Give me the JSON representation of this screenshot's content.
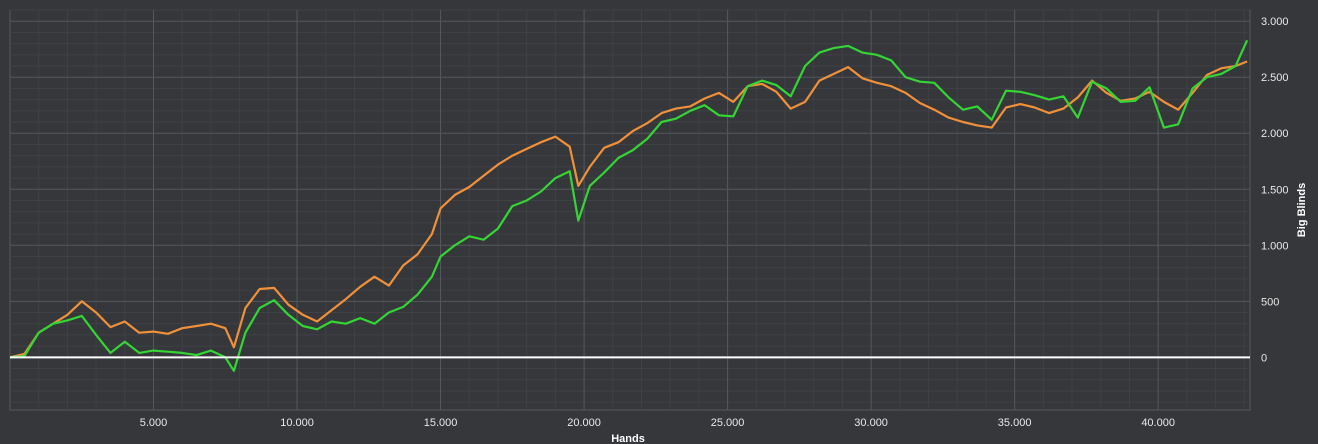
{
  "colors": {
    "background": "#35373b",
    "grid_major": "#55585c",
    "grid_minor": "#3e4145",
    "zero_line": "#ffffff",
    "series_orange": "#f0913a",
    "series_green": "#34d534"
  },
  "chart_data": {
    "type": "line",
    "title": "",
    "xlabel": "Hands",
    "ylabel": "Big Blinds",
    "xlim": [
      0,
      43200
    ],
    "ylim": [
      -470,
      3100
    ],
    "grid": true,
    "y_axis_side": "right",
    "x_ticks": [
      5000,
      10000,
      15000,
      20000,
      25000,
      30000,
      35000,
      40000
    ],
    "x_tick_labels": [
      "5.000",
      "10.000",
      "15.000",
      "20.000",
      "25.000",
      "30.000",
      "35.000",
      "40.000"
    ],
    "y_ticks": [
      0,
      500,
      1000,
      1500,
      2000,
      2500,
      3000
    ],
    "y_tick_labels": [
      "0",
      "500",
      "1.000",
      "1.500",
      "2.000",
      "2.500",
      "3.000"
    ],
    "series": [
      {
        "color": "#f0913a",
        "x": [
          0,
          500,
          1000,
          1500,
          2000,
          2500,
          3000,
          3500,
          4000,
          4500,
          5000,
          5500,
          6000,
          6500,
          7000,
          7500,
          7800,
          8200,
          8700,
          9200,
          9700,
          10200,
          10700,
          11200,
          11700,
          12200,
          12700,
          13200,
          13700,
          14200,
          14700,
          15000,
          15500,
          16000,
          16500,
          17000,
          17500,
          18000,
          18500,
          19000,
          19500,
          19800,
          20200,
          20700,
          21200,
          21700,
          22200,
          22700,
          23200,
          23700,
          24200,
          24700,
          25200,
          25700,
          26200,
          26700,
          27200,
          27700,
          28200,
          28700,
          29200,
          29700,
          30200,
          30700,
          31200,
          31700,
          32200,
          32700,
          33200,
          33700,
          34200,
          34700,
          35200,
          35700,
          36200,
          36700,
          37200,
          37700,
          38200,
          38700,
          39200,
          39700,
          40200,
          40700,
          41200,
          41700,
          42200,
          42700,
          43100
        ],
        "y": [
          0,
          30,
          220,
          300,
          380,
          500,
          400,
          270,
          320,
          220,
          230,
          210,
          260,
          280,
          300,
          260,
          90,
          440,
          610,
          620,
          470,
          380,
          320,
          420,
          520,
          630,
          720,
          640,
          820,
          920,
          1100,
          1330,
          1450,
          1520,
          1620,
          1720,
          1800,
          1860,
          1920,
          1970,
          1880,
          1530,
          1700,
          1870,
          1920,
          2020,
          2090,
          2180,
          2220,
          2240,
          2310,
          2360,
          2280,
          2420,
          2440,
          2370,
          2220,
          2280,
          2470,
          2530,
          2590,
          2490,
          2450,
          2420,
          2360,
          2270,
          2210,
          2140,
          2100,
          2070,
          2050,
          2230,
          2260,
          2230,
          2180,
          2220,
          2320,
          2470,
          2360,
          2290,
          2310,
          2370,
          2280,
          2210,
          2360,
          2520,
          2580,
          2600,
          2640
        ]
      },
      {
        "color": "#34d534",
        "x": [
          0,
          500,
          1000,
          1500,
          2000,
          2500,
          3000,
          3500,
          4000,
          4500,
          5000,
          5500,
          6000,
          6500,
          7000,
          7500,
          7800,
          8200,
          8700,
          9200,
          9700,
          10200,
          10700,
          11200,
          11700,
          12200,
          12700,
          13200,
          13700,
          14200,
          14700,
          15000,
          15500,
          16000,
          16500,
          17000,
          17500,
          18000,
          18500,
          19000,
          19500,
          19800,
          20200,
          20700,
          21200,
          21700,
          22200,
          22700,
          23200,
          23700,
          24200,
          24700,
          25200,
          25700,
          26200,
          26700,
          27200,
          27700,
          28200,
          28700,
          29200,
          29700,
          30200,
          30700,
          31200,
          31700,
          32200,
          32700,
          33200,
          33700,
          34200,
          34700,
          35200,
          35700,
          36200,
          36700,
          37200,
          37700,
          38200,
          38700,
          39200,
          39700,
          40200,
          40700,
          41200,
          41700,
          42200,
          42700,
          43100
        ],
        "y": [
          0,
          10,
          220,
          300,
          330,
          370,
          200,
          40,
          140,
          40,
          60,
          50,
          40,
          20,
          60,
          0,
          -120,
          220,
          440,
          510,
          380,
          280,
          250,
          320,
          300,
          350,
          300,
          400,
          450,
          560,
          720,
          900,
          1000,
          1080,
          1050,
          1150,
          1350,
          1400,
          1480,
          1600,
          1660,
          1220,
          1530,
          1650,
          1780,
          1850,
          1950,
          2100,
          2130,
          2200,
          2250,
          2160,
          2150,
          2420,
          2470,
          2430,
          2330,
          2600,
          2720,
          2760,
          2780,
          2720,
          2700,
          2650,
          2500,
          2460,
          2450,
          2320,
          2210,
          2240,
          2120,
          2380,
          2370,
          2340,
          2300,
          2330,
          2140,
          2460,
          2400,
          2280,
          2290,
          2410,
          2050,
          2080,
          2400,
          2500,
          2530,
          2600,
          2830
        ]
      }
    ]
  }
}
